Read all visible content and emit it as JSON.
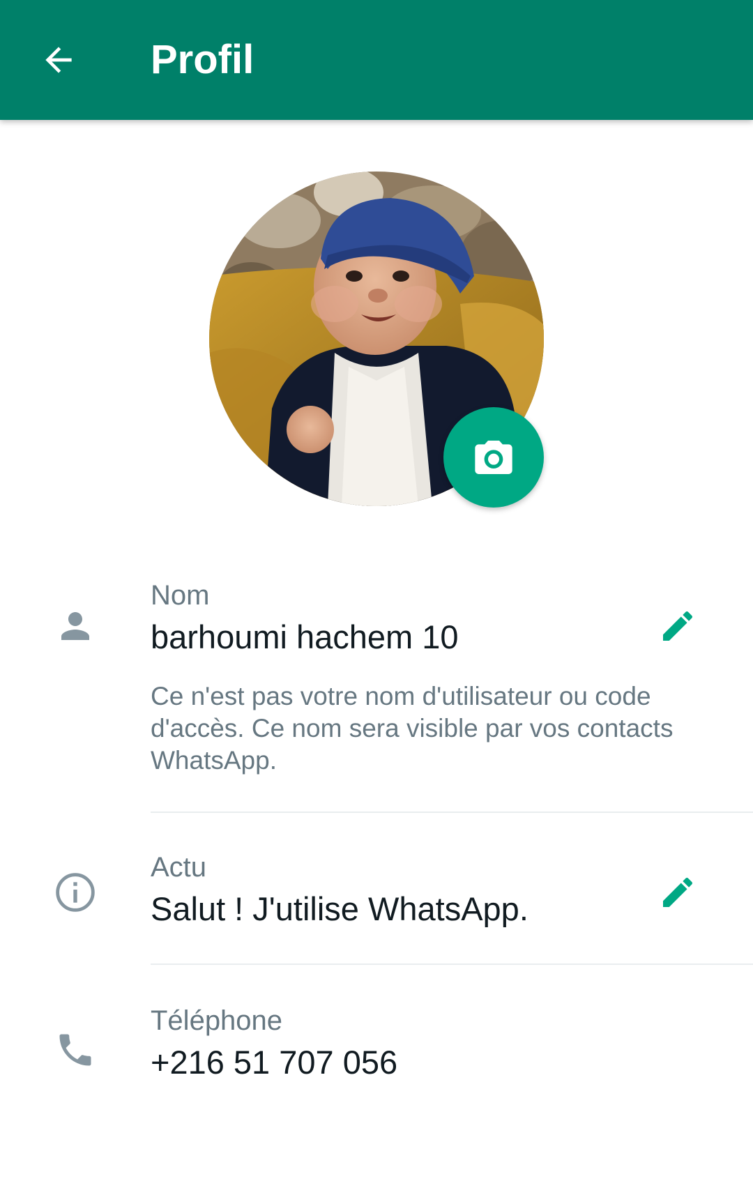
{
  "colors": {
    "header": "#008069",
    "accent": "#00a884",
    "icon_gray": "#8696a0",
    "label_gray": "#667781",
    "text_primary": "#111b21"
  },
  "header": {
    "title": "Profil",
    "back_icon": "arrow-left-icon"
  },
  "avatar": {
    "camera_icon": "camera-icon"
  },
  "name_row": {
    "icon": "person-icon",
    "label": "Nom",
    "value": "barhoumi hachem 10",
    "hint": "Ce n'est pas votre nom d'utilisateur ou code d'accès. Ce nom sera visible par vos contacts WhatsApp.",
    "edit_icon": "pencil-icon"
  },
  "about_row": {
    "icon": "info-icon",
    "label": "Actu",
    "value": "Salut ! J'utilise WhatsApp.",
    "edit_icon": "pencil-icon"
  },
  "phone_row": {
    "icon": "phone-icon",
    "label": "Téléphone",
    "value": "+216 51 707 056"
  }
}
